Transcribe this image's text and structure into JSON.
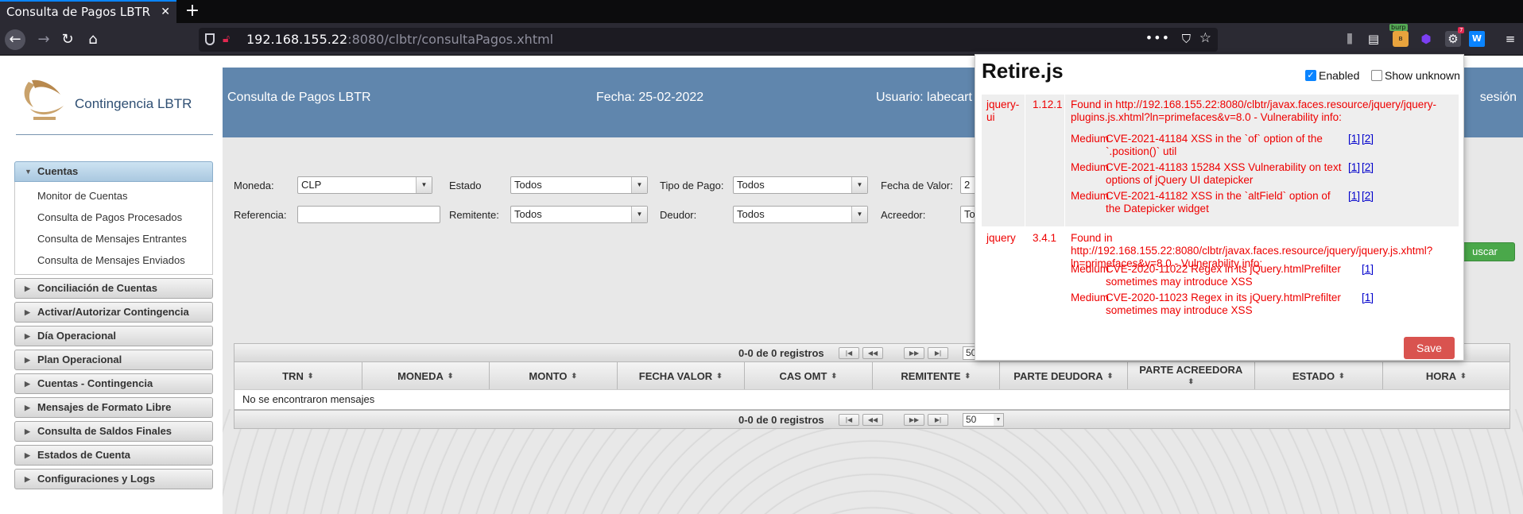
{
  "browser": {
    "tab_title": "Consulta de Pagos LBTR",
    "tab_close": "✕",
    "new_tab": "+",
    "url_host": "192.168.155.22",
    "url_rest": ":8080/clbtr/consultaPagos.xhtml",
    "url_more": "•••",
    "ext_burp_label": "burp",
    "ext_badge": "7",
    "ext_w": "W"
  },
  "sidebar": {
    "app_title": "Contingencia LBTR",
    "menu": [
      {
        "label": "Cuentas",
        "open": true,
        "items": [
          "Monitor de Cuentas",
          "Consulta de Pagos Procesados",
          "Consulta de Mensajes Entrantes",
          "Consulta de Mensajes Enviados"
        ]
      },
      {
        "label": "Conciliación de Cuentas"
      },
      {
        "label": "Activar/Autorizar Contingencia"
      },
      {
        "label": "Día Operacional"
      },
      {
        "label": "Plan Operacional"
      },
      {
        "label": "Cuentas - Contingencia"
      },
      {
        "label": "Mensajes de Formato Libre"
      },
      {
        "label": "Consulta de Saldos Finales"
      },
      {
        "label": "Estados de Cuenta"
      },
      {
        "label": "Configuraciones y Logs"
      }
    ]
  },
  "header": {
    "title": "Consulta de Pagos LBTR",
    "date": "Fecha: 25-02-2022",
    "user": "Usuario: labecart",
    "logout": "sesión"
  },
  "form": {
    "moneda_label": "Moneda:",
    "moneda_value": "CLP",
    "estado_label": "Estado",
    "estado_value": "Todos",
    "tipo_label": "Tipo de Pago:",
    "tipo_value": "Todos",
    "fecha_label": "Fecha de Valor:",
    "fecha_value": "2",
    "referencia_label": "Referencia:",
    "referencia_value": "",
    "remitente_label": "Remitente:",
    "remitente_value": "Todos",
    "deudor_label": "Deudor:",
    "deudor_value": "Todos",
    "acreedor_label": "Acreedor:",
    "acreedor_value": "To",
    "buscar_label": "uscar"
  },
  "table": {
    "count": "0-0 de 0 registros",
    "rows_per_page": "50",
    "columns": [
      "TRN",
      "MONEDA",
      "MONTO",
      "FECHA VALOR",
      "CAS OMT",
      "REMITENTE",
      "PARTE DEUDORA",
      "PARTE ACREEDORA",
      "ESTADO",
      "HORA"
    ],
    "empty_message": "No se encontraron mensajes",
    "pager_first": "◀◀",
    "pager_prev": "◀◀",
    "pager_next": "▶▶",
    "pager_last": "▶▶"
  },
  "retire": {
    "title": "Retire.js",
    "enabled_label": "Enabled",
    "enabled": true,
    "show_unknown_label": "Show unknown",
    "show_unknown": false,
    "libraries": [
      {
        "name": "jquery-ui",
        "version": "1.12.1",
        "found": "Found in http://192.168.155.22:8080/clbtr/javax.faces.resource/jquery/jquery-plugins.js.xhtml?ln=primefaces&v=8.0 - Vulnerability info:",
        "vulns": [
          {
            "severity": "Medium",
            "desc": "CVE-2021-41184 XSS in the `of` option of the `.position()` util",
            "refs": [
              "[1]",
              "[2]"
            ]
          },
          {
            "severity": "Medium",
            "desc": "CVE-2021-41183 15284 XSS Vulnerability on text options of jQuery UI datepicker",
            "refs": [
              "[1]",
              "[2]"
            ]
          },
          {
            "severity": "Medium",
            "desc": "CVE-2021-41182 XSS in the `altField` option of the Datepicker widget",
            "refs": [
              "[1]",
              "[2]"
            ]
          }
        ]
      },
      {
        "name": "jquery",
        "version": "3.4.1",
        "found": "Found in http://192.168.155.22:8080/clbtr/javax.faces.resource/jquery/jquery.js.xhtml?ln=primefaces&v=8.0 - Vulnerability info:",
        "vulns": [
          {
            "severity": "Medium",
            "desc": "CVE-2020-11022 Regex in its jQuery.htmlPrefilter sometimes may introduce XSS",
            "refs": [
              "[1]"
            ]
          },
          {
            "severity": "Medium",
            "desc": "CVE-2020-11023 Regex in its jQuery.htmlPrefilter sometimes may introduce XSS",
            "refs": [
              "[1]"
            ]
          }
        ]
      }
    ],
    "save_label": "Save"
  }
}
